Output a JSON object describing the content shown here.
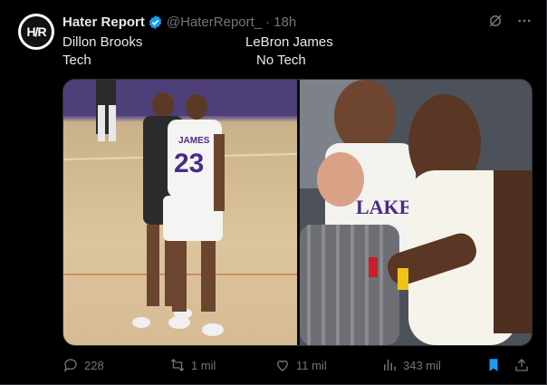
{
  "author": {
    "avatar_text": "H/R",
    "display_name": "Hater Report",
    "handle": "@HaterReport_",
    "separator": "·",
    "time": "18h"
  },
  "tweet": {
    "col1_line1": "Dillon Brooks",
    "col1_line2": "Tech",
    "col2_line1": "LeBron James",
    "col2_line2": "No Tech"
  },
  "media": {
    "left_jersey_name": "JAMES",
    "left_jersey_number": "23",
    "right_jersey_text": "LAKERS"
  },
  "actions": {
    "replies": "228",
    "reposts": "1 mil",
    "likes": "11 mil",
    "views": "343 mil"
  },
  "colors": {
    "background": "#000000",
    "text": "#e7e9ea",
    "muted": "#71767b",
    "accent": "#1d9bf0"
  },
  "icons": [
    "verified-icon",
    "grok-icon",
    "more-icon",
    "reply-icon",
    "repost-icon",
    "like-icon",
    "views-icon",
    "bookmark-icon",
    "share-icon"
  ]
}
